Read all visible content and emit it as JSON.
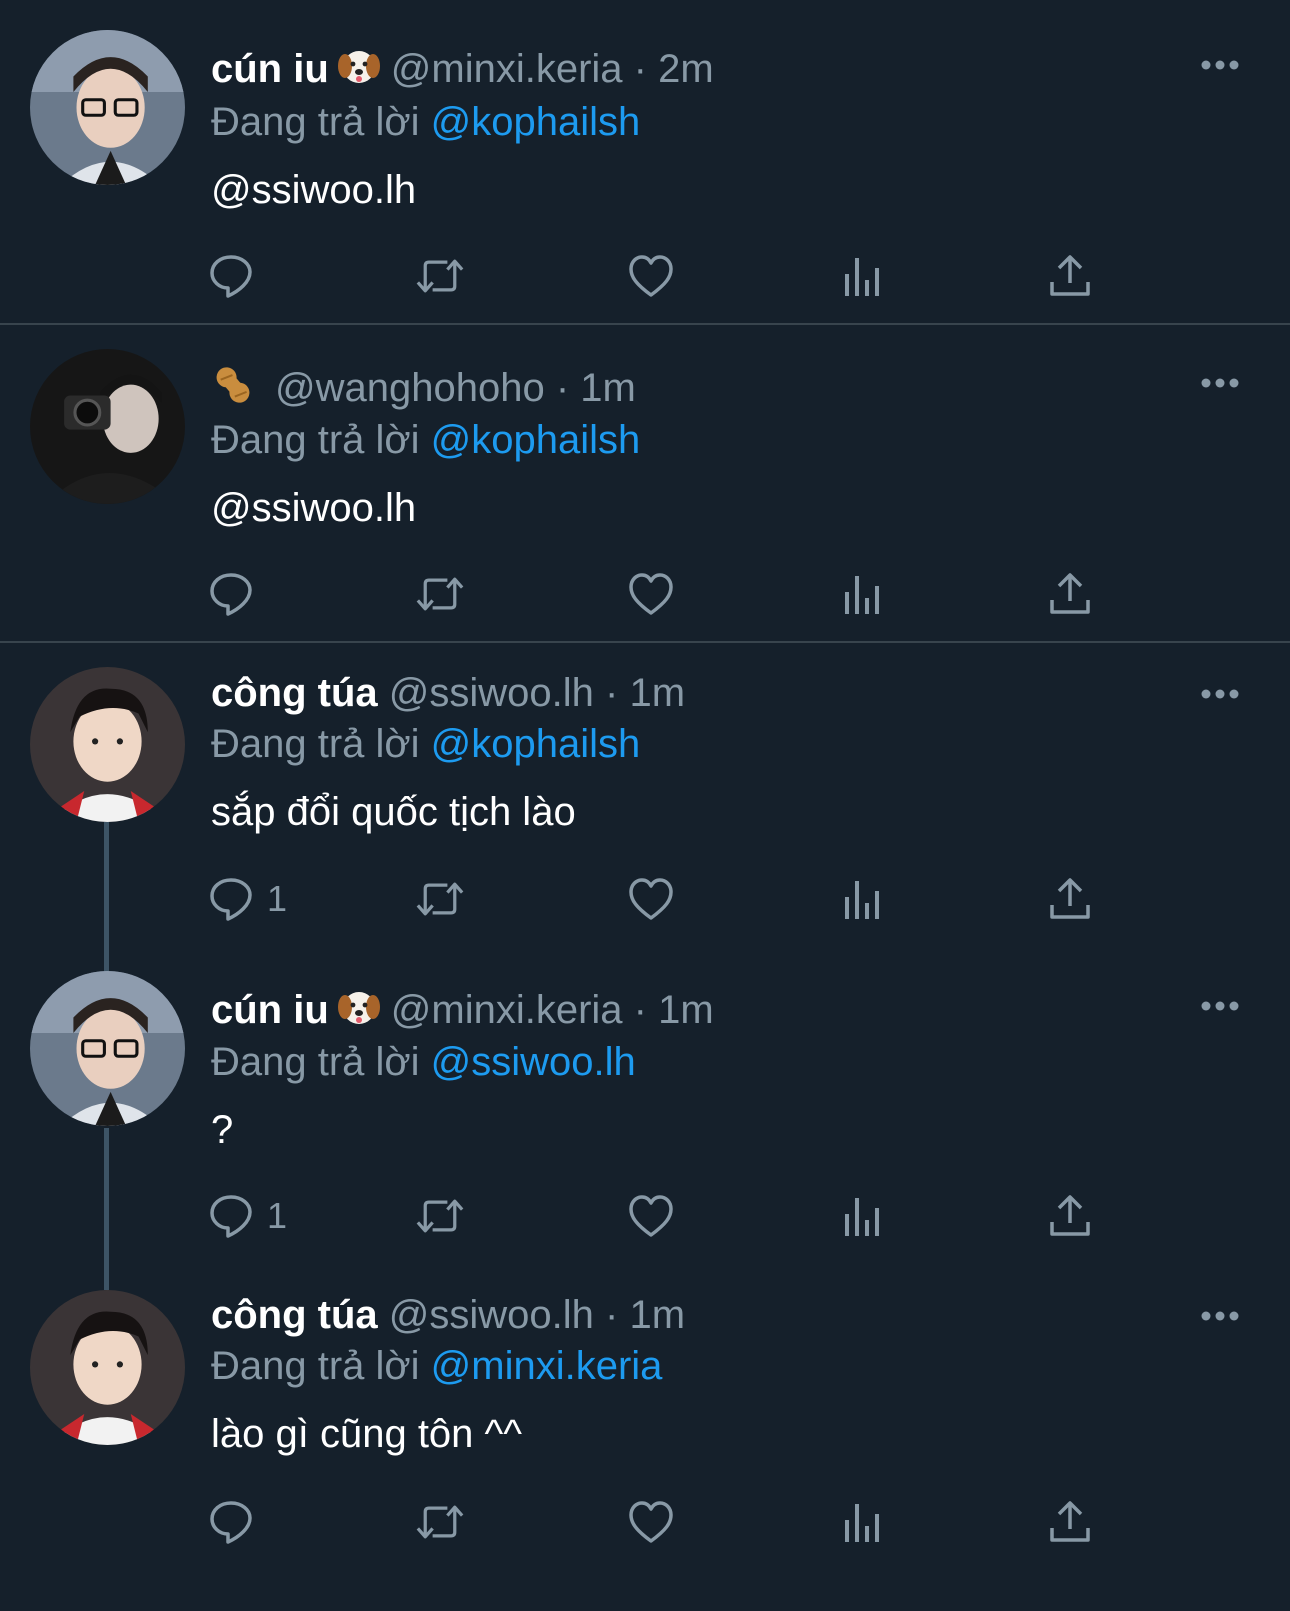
{
  "colors": {
    "background": "#15202b",
    "accent": "#1d9bf0",
    "muted": "#8899a6",
    "divider": "#38444d"
  },
  "tweets": [
    {
      "name": "cún iu",
      "emoji": "dog-face-icon",
      "handle": "@minxi.keria",
      "dot": "·",
      "time": "2m",
      "reply_prefix": "Đang trả lời",
      "reply_to": "@kophailsh",
      "body": "@ssiwoo.lh",
      "body_is_mention": true,
      "reply_count": ""
    },
    {
      "name": "",
      "emoji": "peanut-icon",
      "handle": "@wanghohoho",
      "dot": "·",
      "time": "1m",
      "reply_prefix": "Đang trả lời",
      "reply_to": "@kophailsh",
      "body": "@ssiwoo.lh",
      "body_is_mention": true,
      "reply_count": ""
    },
    {
      "name": "công túa",
      "emoji": "",
      "handle": "@ssiwoo.lh",
      "dot": "·",
      "time": "1m",
      "reply_prefix": "Đang trả lời",
      "reply_to": "@kophailsh",
      "body": "sắp đổi quốc tịch lào",
      "body_is_mention": false,
      "reply_count": "1"
    },
    {
      "name": "cún iu",
      "emoji": "dog-face-icon",
      "handle": "@minxi.keria",
      "dot": "·",
      "time": "1m",
      "reply_prefix": "Đang trả lời",
      "reply_to": "@ssiwoo.lh",
      "body": "?",
      "body_is_mention": false,
      "reply_count": "1"
    },
    {
      "name": "công túa",
      "emoji": "",
      "handle": "@ssiwoo.lh",
      "dot": "·",
      "time": "1m",
      "reply_prefix": "Đang trả lời",
      "reply_to": "@minxi.keria",
      "body": "lào gì cũng tôn ^^",
      "body_is_mention": false,
      "reply_count": ""
    }
  ]
}
